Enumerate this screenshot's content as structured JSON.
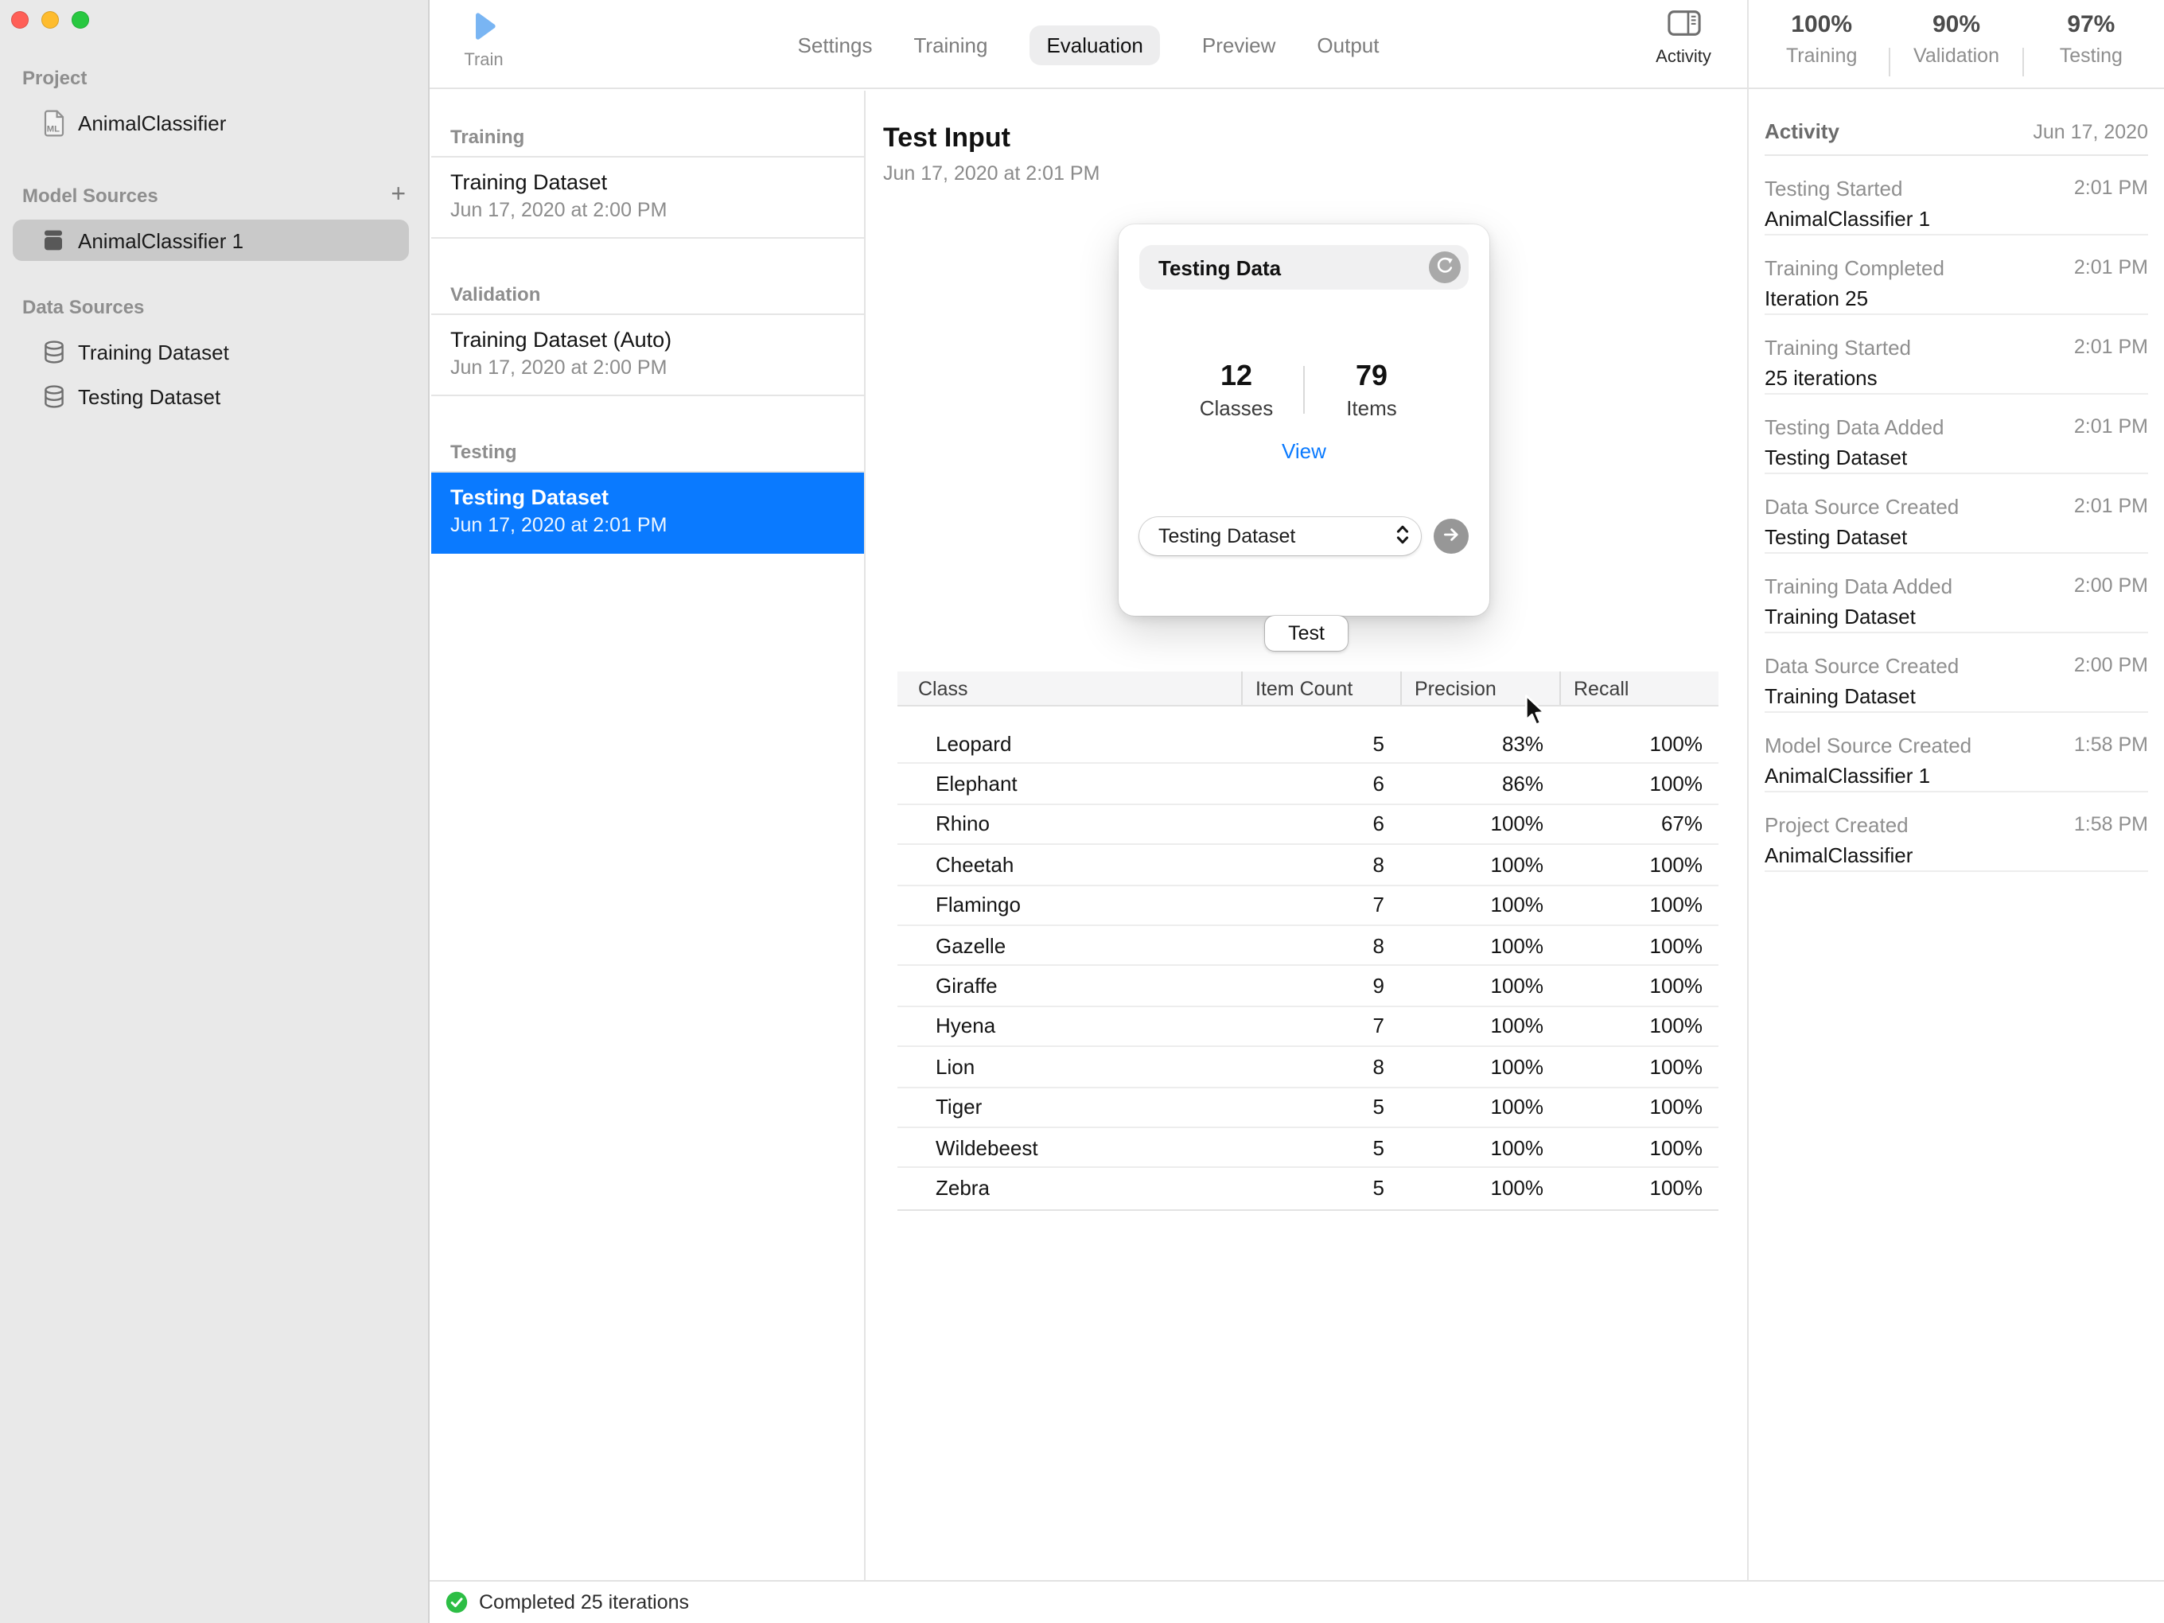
{
  "window": {
    "controls": [
      "close",
      "minimize",
      "zoom"
    ]
  },
  "sidebar": {
    "sections": [
      {
        "header": "Project",
        "items": [
          {
            "label": "AnimalClassifier",
            "icon": "ml-document",
            "selected": false
          }
        ]
      },
      {
        "header": "Model Sources",
        "action": "+",
        "items": [
          {
            "label": "AnimalClassifier 1",
            "icon": "model",
            "selected": true
          }
        ]
      },
      {
        "header": "Data Sources",
        "items": [
          {
            "label": "Training Dataset",
            "icon": "database",
            "selected": false
          },
          {
            "label": "Testing Dataset",
            "icon": "database",
            "selected": false
          }
        ]
      }
    ]
  },
  "toolbar": {
    "train_label": "Train",
    "tabs": [
      {
        "label": "Settings",
        "selected": false
      },
      {
        "label": "Training",
        "selected": false
      },
      {
        "label": "Evaluation",
        "selected": true
      },
      {
        "label": "Preview",
        "selected": false
      },
      {
        "label": "Output",
        "selected": false
      }
    ],
    "activity_label": "Activity",
    "stats": [
      {
        "value": "100%",
        "label": "Training"
      },
      {
        "value": "90%",
        "label": "Validation"
      },
      {
        "value": "97%",
        "label": "Testing"
      }
    ]
  },
  "dataset_list": {
    "sections": [
      {
        "header": "Training",
        "items": [
          {
            "title": "Training Dataset",
            "subtitle": "Jun 17, 2020 at 2:00 PM",
            "selected": false
          }
        ]
      },
      {
        "header": "Validation",
        "items": [
          {
            "title": "Training Dataset (Auto)",
            "subtitle": "Jun 17, 2020 at 2:00 PM",
            "selected": false
          }
        ]
      },
      {
        "header": "Testing",
        "items": [
          {
            "title": "Testing Dataset",
            "subtitle": "Jun 17, 2020 at 2:01 PM",
            "selected": true
          }
        ]
      }
    ]
  },
  "detail": {
    "title": "Test Input",
    "subtitle": "Jun 17, 2020 at 2:01 PM",
    "card": {
      "title": "Testing Data",
      "stats": [
        {
          "value": "12",
          "label": "Classes"
        },
        {
          "value": "79",
          "label": "Items"
        }
      ],
      "view_link": "View",
      "dataset_select": {
        "value": "Testing Dataset"
      }
    },
    "test_button": "Test",
    "results_table": {
      "columns": [
        "Class",
        "Item Count",
        "Precision",
        "Recall"
      ],
      "rows": [
        [
          "Leopard",
          "5",
          "83%",
          "100%"
        ],
        [
          "Elephant",
          "6",
          "86%",
          "100%"
        ],
        [
          "Rhino",
          "6",
          "100%",
          "67%"
        ],
        [
          "Cheetah",
          "8",
          "100%",
          "100%"
        ],
        [
          "Flamingo",
          "7",
          "100%",
          "100%"
        ],
        [
          "Gazelle",
          "8",
          "100%",
          "100%"
        ],
        [
          "Giraffe",
          "9",
          "100%",
          "100%"
        ],
        [
          "Hyena",
          "7",
          "100%",
          "100%"
        ],
        [
          "Lion",
          "8",
          "100%",
          "100%"
        ],
        [
          "Tiger",
          "5",
          "100%",
          "100%"
        ],
        [
          "Wildebeest",
          "5",
          "100%",
          "100%"
        ],
        [
          "Zebra",
          "5",
          "100%",
          "100%"
        ]
      ]
    }
  },
  "activity_panel": {
    "header": "Activity",
    "date": "Jun 17, 2020",
    "entries": [
      {
        "title": "Testing Started",
        "time": "2:01 PM",
        "subtitle": "AnimalClassifier 1"
      },
      {
        "title": "Training Completed",
        "time": "2:01 PM",
        "subtitle": "Iteration 25"
      },
      {
        "title": "Training Started",
        "time": "2:01 PM",
        "subtitle": "25 iterations"
      },
      {
        "title": "Testing Data Added",
        "time": "2:01 PM",
        "subtitle": "Testing Dataset"
      },
      {
        "title": "Data Source Created",
        "time": "2:01 PM",
        "subtitle": "Testing Dataset"
      },
      {
        "title": "Training Data Added",
        "time": "2:00 PM",
        "subtitle": "Training Dataset"
      },
      {
        "title": "Data Source Created",
        "time": "2:00 PM",
        "subtitle": "Training Dataset"
      },
      {
        "title": "Model Source Created",
        "time": "1:58 PM",
        "subtitle": "AnimalClassifier 1"
      },
      {
        "title": "Project Created",
        "time": "1:58 PM",
        "subtitle": "AnimalClassifier"
      }
    ]
  },
  "status_bar": {
    "text": "Completed 25 iterations",
    "icon": "check-circle-icon"
  },
  "colors": {
    "accent_blue": "#0a7aff",
    "link_blue": "#0a7aff",
    "success_green": "#2dbe45",
    "train_play_blue": "#79b5f3",
    "sidebar_selected_gray": "#c9c9c9",
    "sidebar_background": "#e9e9e9",
    "traffic_red": "#ff5f57",
    "traffic_yellow": "#febc2e",
    "traffic_green": "#28c840"
  }
}
